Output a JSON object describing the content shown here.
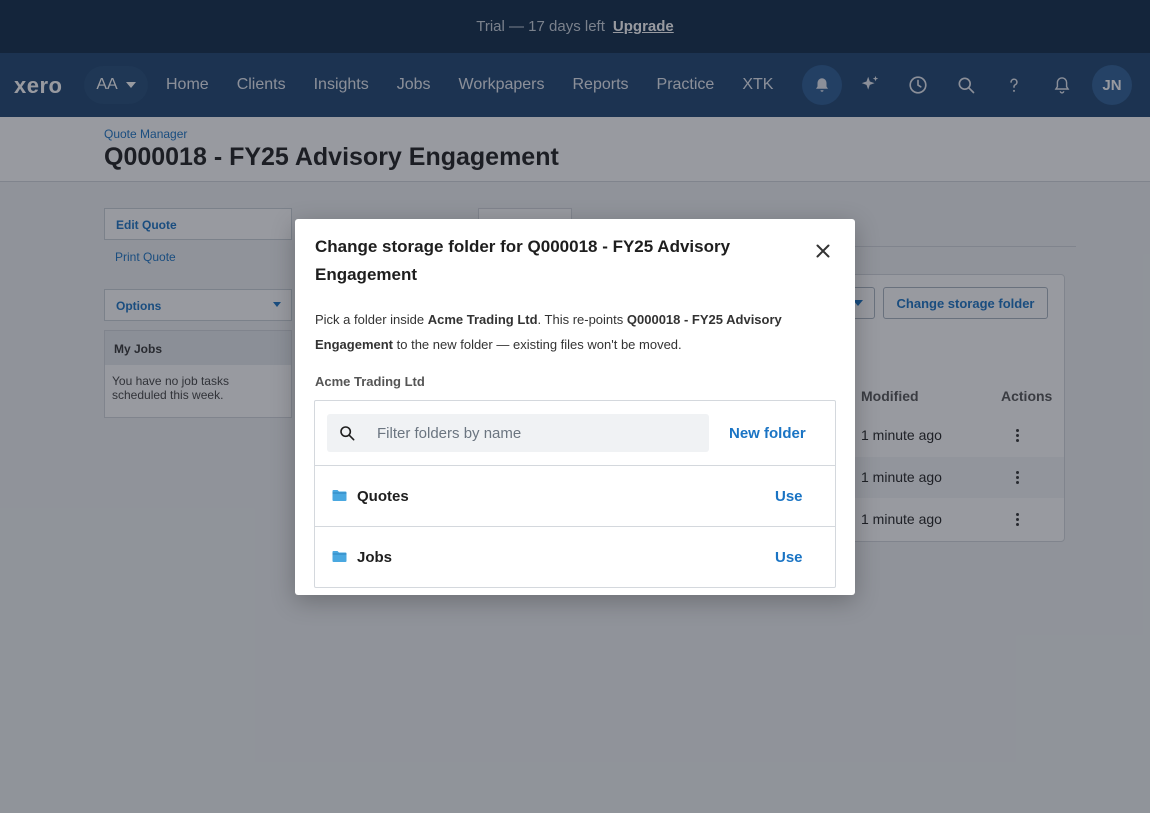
{
  "trial": {
    "text": "Trial — 17 days left",
    "upgrade_label": "Upgrade"
  },
  "nav": {
    "logo": "xero",
    "org_label": "AA",
    "links": [
      "Home",
      "Clients",
      "Insights",
      "Jobs",
      "Workpapers",
      "Reports",
      "Practice",
      "XTK"
    ],
    "icons": [
      "notification-bell-icon",
      "ai-sparkle-icon",
      "history-clock-icon",
      "search-icon",
      "help-icon",
      "bell-icon"
    ],
    "avatar_initials": "JN"
  },
  "page": {
    "breadcrumb": "Quote Manager",
    "title": "Q000018 - FY25 Advisory Engagement"
  },
  "sidebar": {
    "edit_quote": "Edit Quote",
    "print_quote": "Print Quote",
    "options": "Options",
    "my_jobs_title": "My Jobs",
    "my_jobs_text": "You have no job tasks scheduled this week."
  },
  "files": {
    "change_storage_label": "Change storage folder",
    "columns": {
      "modified": "Modified",
      "actions": "Actions"
    },
    "rows": [
      {
        "modified": "1 minute ago"
      },
      {
        "modified": "1 minute ago"
      },
      {
        "modified": "1 minute ago"
      }
    ]
  },
  "modal": {
    "title": "Change storage folder for Q000018 - FY25 Advisory Engagement",
    "desc_prefix": "Pick a folder inside ",
    "desc_org": "Acme Trading Ltd",
    "desc_mid": ". This re-points ",
    "desc_quote": "Q000018 - FY25 Advisory Engagement",
    "desc_suffix": " to the new folder — existing files won't be moved.",
    "parent_folder": "Acme Trading Ltd",
    "search_placeholder": "Filter folders by name",
    "new_folder_label": "New folder",
    "folders": [
      {
        "name": "Quotes",
        "action": "Use"
      },
      {
        "name": "Jobs",
        "action": "Use"
      }
    ]
  },
  "colors": {
    "trial_bar": "#0f2a48",
    "nav_bar": "#1e446f",
    "link_blue": "#1a74c4",
    "folder_icon": "#4aa8e0"
  }
}
